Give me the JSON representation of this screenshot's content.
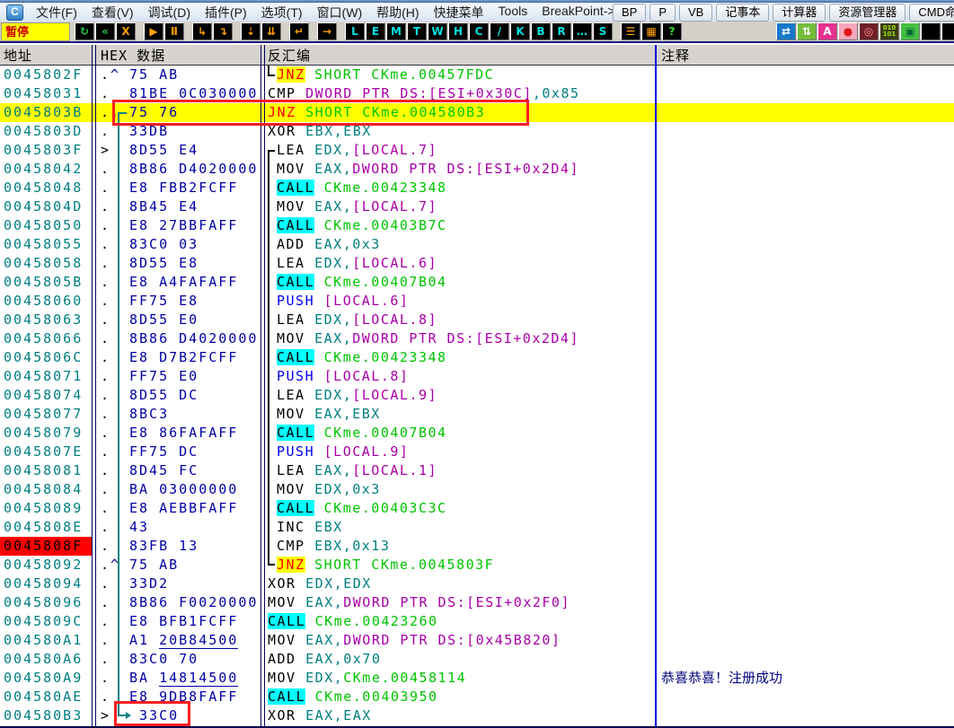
{
  "window": {
    "icon_label": "C",
    "status": "暂停"
  },
  "menubar": {
    "items": [
      "文件(F)",
      "查看(V)",
      "调试(D)",
      "插件(P)",
      "选项(T)",
      "窗口(W)",
      "帮助(H)",
      "快捷菜单",
      "Tools",
      "BreakPoint->"
    ],
    "quick_buttons": [
      "BP",
      "P",
      "VB",
      "记事本",
      "计算器",
      "资源管理器",
      "CMD命令"
    ]
  },
  "toolbar": {
    "status": "暂停",
    "buttons": [
      {
        "name": "restart-button",
        "glyph": "↻",
        "fg": "#22CC44",
        "gap": false
      },
      {
        "name": "step-back-button",
        "glyph": "«",
        "fg": "#22CC44"
      },
      {
        "name": "close-button",
        "glyph": "X",
        "fg": "#FFA000"
      },
      {
        "name": "run-button",
        "glyph": "▶",
        "fg": "#FFA000",
        "gap": true
      },
      {
        "name": "pause-button",
        "glyph": "Ⅱ",
        "fg": "#FFA000"
      },
      {
        "name": "step-into-button",
        "glyph": "↳",
        "fg": "#FFA000",
        "gap": true
      },
      {
        "name": "step-over-button",
        "glyph": "↴",
        "fg": "#FFA000"
      },
      {
        "name": "animate-into-button",
        "glyph": "⇣",
        "fg": "#FFA000",
        "gap": true
      },
      {
        "name": "animate-over-button",
        "glyph": "⇊",
        "fg": "#FFA000"
      },
      {
        "name": "execute-till-return-button",
        "glyph": "↵",
        "fg": "#FFA000",
        "gap": true
      },
      {
        "name": "goto-button",
        "glyph": "→",
        "fg": "#FFA000",
        "gap": true
      },
      {
        "name": "log-window-button",
        "glyph": "L",
        "fg": "#00E0E0",
        "gap": true
      },
      {
        "name": "executables-button",
        "glyph": "E",
        "fg": "#00E0E0"
      },
      {
        "name": "memory-map-button",
        "glyph": "M",
        "fg": "#00E0E0"
      },
      {
        "name": "threads-button",
        "glyph": "T",
        "fg": "#00E0E0"
      },
      {
        "name": "windows-button",
        "glyph": "W",
        "fg": "#00E0E0"
      },
      {
        "name": "handles-button",
        "glyph": "H",
        "fg": "#00E0E0"
      },
      {
        "name": "cpu-button",
        "glyph": "C",
        "fg": "#00E0E0"
      },
      {
        "name": "patches-button",
        "glyph": "/",
        "fg": "#00E0E0"
      },
      {
        "name": "call-stack-button",
        "glyph": "K",
        "fg": "#00E0E0"
      },
      {
        "name": "breakpoints-button",
        "glyph": "B",
        "fg": "#00E0E0"
      },
      {
        "name": "references-button",
        "glyph": "R",
        "fg": "#00E0E0"
      },
      {
        "name": "run-trace-button",
        "glyph": "…",
        "fg": "#00E0E0"
      },
      {
        "name": "source-button",
        "glyph": "S",
        "fg": "#00E0E0"
      },
      {
        "name": "options-button",
        "glyph": "☰",
        "fg": "#FFA000",
        "gap": true
      },
      {
        "name": "appearance-button",
        "glyph": "▦",
        "fg": "#FFA000"
      },
      {
        "name": "help-button",
        "glyph": "?",
        "fg": "#33DD33"
      },
      {
        "name": "swap-arrows-button",
        "glyph": "⇄",
        "fg": "#FFFFFF",
        "bg": "#1878C8",
        "biggap": true
      },
      {
        "name": "updown-arrows-button",
        "glyph": "⇅",
        "fg": "#FFFFFF",
        "bg": "#74BE3C"
      },
      {
        "name": "assembler-button",
        "glyph": "A",
        "fg": "#FFFFFF",
        "bg": "#E83090"
      },
      {
        "name": "record-button",
        "glyph": "●",
        "fg": "#E01818",
        "bg": "#F4A8BC"
      },
      {
        "name": "target-button",
        "glyph": "◎",
        "fg": "#FF9090",
        "bg": "#6E2026"
      },
      {
        "name": "binary-button",
        "glyph": "010 101",
        "fg": "#9BE000",
        "bg": "#3C3C14",
        "tiny": true
      },
      {
        "name": "window-button",
        "glyph": "▣",
        "fg": "#006633",
        "bg": "#44C044"
      },
      {
        "name": "blank-button-1",
        "glyph": "",
        "fg": "#000000",
        "bg": "#000000"
      },
      {
        "name": "blank-button-2",
        "glyph": "",
        "fg": "#000000",
        "bg": "#000000"
      },
      {
        "name": "blank-button-3",
        "glyph": "",
        "fg": "#000000",
        "bg": "#000000"
      },
      {
        "name": "blank-button-4",
        "glyph": "",
        "fg": "#000000",
        "bg": "#000000"
      }
    ]
  },
  "table": {
    "headers": {
      "address": "地址",
      "hex": "HEX 数据",
      "disasm": "反汇编",
      "comment": "注释"
    },
    "rows": [
      {
        "a": "0045802F",
        "m1": ".",
        "m2": "^",
        "h1": "75 AB",
        "h2": "",
        "ind": true,
        "t": [
          [
            "jnz",
            "JNZ"
          ],
          [
            "grn",
            " SHORT CKme.00457FDC"
          ]
        ],
        "c": ""
      },
      {
        "a": "00458031",
        "m1": ".",
        "m2": "",
        "h1": "81BE 0C030000",
        "h2": "",
        "ind": false,
        "t": [
          [
            "mn",
            "CMP "
          ],
          [
            "mem",
            "DWORD PTR DS:[ESI+0x30C]"
          ],
          [
            "reg",
            ",0x85"
          ]
        ],
        "c": ""
      },
      {
        "a": "0045803B",
        "m1": ".",
        "m2": ",",
        "h1": "75 76",
        "h2": "",
        "ind": false,
        "bg": "yellow",
        "t": [
          [
            "jnz",
            "JNZ"
          ],
          [
            "grn",
            " SHORT CKme.004580B3"
          ]
        ],
        "c": ""
      },
      {
        "a": "0045803D",
        "m1": ".",
        "m2": "",
        "h1": "33DB",
        "h2": "",
        "ind": false,
        "t": [
          [
            "mn",
            "XOR "
          ],
          [
            "reg",
            "EBX,EBX"
          ]
        ],
        "c": ""
      },
      {
        "a": "0045803F",
        "m1": ">",
        "m2": "",
        "h1": "8D55 E4",
        "h2": "",
        "ind": true,
        "t": [
          [
            "mn",
            "LEA "
          ],
          [
            "reg",
            "EDX,"
          ],
          [
            "mem",
            "[LOCAL.7]"
          ]
        ],
        "c": ""
      },
      {
        "a": "00458042",
        "m1": ".",
        "m2": "",
        "h1": "8B86 D4020000",
        "h2": "",
        "ind": true,
        "t": [
          [
            "mn",
            "MOV "
          ],
          [
            "reg",
            "EAX,"
          ],
          [
            "mem",
            "DWORD PTR DS:[ESI+0x2D4]"
          ]
        ],
        "c": ""
      },
      {
        "a": "00458048",
        "m1": ".",
        "m2": "",
        "h1": "E8 FBB2FCFF",
        "h2": "",
        "ind": true,
        "t": [
          [
            "call",
            "CALL"
          ],
          [
            "grn",
            " CKme.00423348"
          ]
        ],
        "c": ""
      },
      {
        "a": "0045804D",
        "m1": ".",
        "m2": "",
        "h1": "8B45 E4",
        "h2": "",
        "ind": true,
        "t": [
          [
            "mn",
            "MOV "
          ],
          [
            "reg",
            "EAX,"
          ],
          [
            "mem",
            "[LOCAL.7]"
          ]
        ],
        "c": ""
      },
      {
        "a": "00458050",
        "m1": ".",
        "m2": "",
        "h1": "E8 27BBFAFF",
        "h2": "",
        "ind": true,
        "t": [
          [
            "call",
            "CALL"
          ],
          [
            "grn",
            " CKme.00403B7C"
          ]
        ],
        "c": ""
      },
      {
        "a": "00458055",
        "m1": ".",
        "m2": "",
        "h1": "83C0 03",
        "h2": "",
        "ind": true,
        "t": [
          [
            "mn",
            "ADD "
          ],
          [
            "reg",
            "EAX,0x3"
          ]
        ],
        "c": ""
      },
      {
        "a": "00458058",
        "m1": ".",
        "m2": "",
        "h1": "8D55 E8",
        "h2": "",
        "ind": true,
        "t": [
          [
            "mn",
            "LEA "
          ],
          [
            "reg",
            "EDX,"
          ],
          [
            "mem",
            "[LOCAL.6]"
          ]
        ],
        "c": ""
      },
      {
        "a": "0045805B",
        "m1": ".",
        "m2": "",
        "h1": "E8 A4FAFAFF",
        "h2": "",
        "ind": true,
        "t": [
          [
            "call",
            "CALL"
          ],
          [
            "grn",
            " CKme.00407B04"
          ]
        ],
        "c": ""
      },
      {
        "a": "00458060",
        "m1": ".",
        "m2": "",
        "h1": "FF75 E8",
        "h2": "",
        "ind": true,
        "t": [
          [
            "push",
            "PUSH "
          ],
          [
            "mem",
            "[LOCAL.6]"
          ]
        ],
        "c": ""
      },
      {
        "a": "00458063",
        "m1": ".",
        "m2": "",
        "h1": "8D55 E0",
        "h2": "",
        "ind": true,
        "t": [
          [
            "mn",
            "LEA "
          ],
          [
            "reg",
            "EDX,"
          ],
          [
            "mem",
            "[LOCAL.8]"
          ]
        ],
        "c": ""
      },
      {
        "a": "00458066",
        "m1": ".",
        "m2": "",
        "h1": "8B86 D4020000",
        "h2": "",
        "ind": true,
        "t": [
          [
            "mn",
            "MOV "
          ],
          [
            "reg",
            "EAX,"
          ],
          [
            "mem",
            "DWORD PTR DS:[ESI+0x2D4]"
          ]
        ],
        "c": ""
      },
      {
        "a": "0045806C",
        "m1": ".",
        "m2": "",
        "h1": "E8 D7B2FCFF",
        "h2": "",
        "ind": true,
        "t": [
          [
            "call",
            "CALL"
          ],
          [
            "grn",
            " CKme.00423348"
          ]
        ],
        "c": ""
      },
      {
        "a": "00458071",
        "m1": ".",
        "m2": "",
        "h1": "FF75 E0",
        "h2": "",
        "ind": true,
        "t": [
          [
            "push",
            "PUSH "
          ],
          [
            "mem",
            "[LOCAL.8]"
          ]
        ],
        "c": ""
      },
      {
        "a": "00458074",
        "m1": ".",
        "m2": "",
        "h1": "8D55 DC",
        "h2": "",
        "ind": true,
        "t": [
          [
            "mn",
            "LEA "
          ],
          [
            "reg",
            "EDX,"
          ],
          [
            "mem",
            "[LOCAL.9]"
          ]
        ],
        "c": ""
      },
      {
        "a": "00458077",
        "m1": ".",
        "m2": "",
        "h1": "8BC3",
        "h2": "",
        "ind": true,
        "t": [
          [
            "mn",
            "MOV "
          ],
          [
            "reg",
            "EAX,EBX"
          ]
        ],
        "c": ""
      },
      {
        "a": "00458079",
        "m1": ".",
        "m2": "",
        "h1": "E8 86FAFAFF",
        "h2": "",
        "ind": true,
        "t": [
          [
            "call",
            "CALL"
          ],
          [
            "grn",
            " CKme.00407B04"
          ]
        ],
        "c": ""
      },
      {
        "a": "0045807E",
        "m1": ".",
        "m2": "",
        "h1": "FF75 DC",
        "h2": "",
        "ind": true,
        "t": [
          [
            "push",
            "PUSH "
          ],
          [
            "mem",
            "[LOCAL.9]"
          ]
        ],
        "c": ""
      },
      {
        "a": "00458081",
        "m1": ".",
        "m2": "",
        "h1": "8D45 FC",
        "h2": "",
        "ind": true,
        "t": [
          [
            "mn",
            "LEA "
          ],
          [
            "reg",
            "EAX,"
          ],
          [
            "mem",
            "[LOCAL.1]"
          ]
        ],
        "c": ""
      },
      {
        "a": "00458084",
        "m1": ".",
        "m2": "",
        "h1": "BA 03000000",
        "h2": "",
        "ind": true,
        "t": [
          [
            "mn",
            "MOV "
          ],
          [
            "reg",
            "EDX,0x3"
          ]
        ],
        "c": ""
      },
      {
        "a": "00458089",
        "m1": ".",
        "m2": "",
        "h1": "E8 AEBBFAFF",
        "h2": "",
        "ind": true,
        "t": [
          [
            "call",
            "CALL"
          ],
          [
            "grn",
            " CKme.00403C3C"
          ]
        ],
        "c": ""
      },
      {
        "a": "0045808E",
        "m1": ".",
        "m2": "",
        "h1": "43",
        "h2": "",
        "ind": true,
        "t": [
          [
            "mn",
            "INC "
          ],
          [
            "reg",
            "EBX"
          ]
        ],
        "c": ""
      },
      {
        "a": "0045808F",
        "m1": ".",
        "m2": "",
        "h1": "83FB 13",
        "h2": "",
        "ind": true,
        "abg": "red",
        "t": [
          [
            "mn",
            "CMP "
          ],
          [
            "reg",
            "EBX,0x13"
          ]
        ],
        "c": ""
      },
      {
        "a": "00458092",
        "m1": ".",
        "m2": "^",
        "h1": "75 AB",
        "h2": "",
        "ind": true,
        "t": [
          [
            "jnz",
            "JNZ"
          ],
          [
            "grn",
            " SHORT CKme.0045803F"
          ]
        ],
        "c": ""
      },
      {
        "a": "00458094",
        "m1": ".",
        "m2": "",
        "h1": "33D2",
        "h2": "",
        "ind": false,
        "t": [
          [
            "mn",
            "XOR "
          ],
          [
            "reg",
            "EDX,EDX"
          ]
        ],
        "c": ""
      },
      {
        "a": "00458096",
        "m1": ".",
        "m2": "",
        "h1": "8B86 F0020000",
        "h2": "",
        "ind": false,
        "t": [
          [
            "mn",
            "MOV "
          ],
          [
            "reg",
            "EAX,"
          ],
          [
            "mem",
            "DWORD PTR DS:[ESI+0x2F0]"
          ]
        ],
        "c": ""
      },
      {
        "a": "0045809C",
        "m1": ".",
        "m2": "",
        "h1": "E8 BFB1FCFF",
        "h2": "",
        "ind": false,
        "t": [
          [
            "call",
            "CALL"
          ],
          [
            "grn",
            " CKme.00423260"
          ]
        ],
        "c": ""
      },
      {
        "a": "004580A1",
        "m1": ".",
        "m2": "",
        "h1": "A1 ",
        "h2": "20B84500",
        "ind": false,
        "t": [
          [
            "mn",
            "MOV "
          ],
          [
            "reg",
            "EAX,"
          ],
          [
            "mem",
            "DWORD PTR DS:[0x45B820]"
          ]
        ],
        "c": ""
      },
      {
        "a": "004580A6",
        "m1": ".",
        "m2": "",
        "h1": "83C0 70",
        "h2": "",
        "ind": false,
        "t": [
          [
            "mn",
            "ADD "
          ],
          [
            "reg",
            "EAX,0x70"
          ]
        ],
        "c": ""
      },
      {
        "a": "004580A9",
        "m1": ".",
        "m2": "",
        "h1": "BA ",
        "h2": "14814500",
        "ind": false,
        "t": [
          [
            "mn",
            "MOV "
          ],
          [
            "reg",
            "EDX,"
          ],
          [
            "grn",
            "CKme.00458114"
          ]
        ],
        "c": "恭喜恭喜！注册成功"
      },
      {
        "a": "004580AE",
        "m1": ".",
        "m2": "",
        "h1": "E8 9DB8FAFF",
        "h2": "",
        "ind": false,
        "t": [
          [
            "call",
            "CALL"
          ],
          [
            "grn",
            " CKme.00403950"
          ]
        ],
        "c": ""
      },
      {
        "a": "004580B3",
        "m1": ">",
        "m2": "",
        "h1": " 33C0",
        "h2": "",
        "ind": false,
        "t": [
          [
            "mn",
            "XOR "
          ],
          [
            "reg",
            "EAX,EAX"
          ]
        ],
        "c": ""
      }
    ]
  },
  "colors": {
    "highlight_row": "#FFFF00",
    "breakpoint_red": "#FF0000",
    "address_teal": "#007F82",
    "hex_navy": "#0000A5",
    "jump_green": "#00C400",
    "memory_magenta": "#A800A8",
    "call_highlight_cyan": "#00FFFF",
    "push_blue": "#0000EE",
    "jnz_red_on_yellow": "#FF0000",
    "comment_navy": "#00007B",
    "annotation_red": "#FF1E1E",
    "jump_arrow_teal": "#0E8080"
  }
}
